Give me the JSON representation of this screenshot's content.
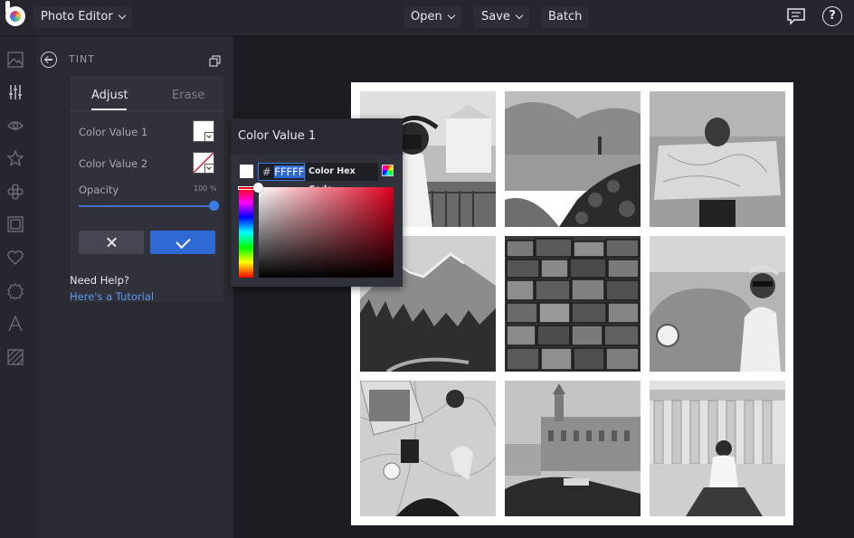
{
  "topbar": {
    "app_menu_label": "Photo Editor",
    "open_label": "Open",
    "save_label": "Save",
    "batch_label": "Batch",
    "help_glyph": "?"
  },
  "rail": {
    "icons": [
      "image-icon",
      "sliders-icon",
      "eye-icon",
      "star-icon",
      "shapes-icon",
      "frame-icon",
      "heart-icon",
      "badge-icon",
      "text-icon",
      "texture-icon"
    ]
  },
  "panel": {
    "title": "TINT",
    "tabs": {
      "adjust": "Adjust",
      "erase": "Erase"
    },
    "color_value_1_label": "Color Value 1",
    "color_value_2_label": "Color Value 2",
    "opacity_label": "Opacity",
    "opacity_value": "100 %",
    "opacity_level": 1.0,
    "help_title": "Need Help?",
    "help_link": "Here's a Tutorial"
  },
  "color_picker": {
    "title": "Color Value 1",
    "hex_prefix": "#",
    "hex_value": "FFFFF",
    "tooltip": "Color Hex Code",
    "current_color": "#ffffff"
  },
  "canvas": {
    "photos": [
      "woman-with-camera-photo",
      "rocky-coast-lighthouse-photo",
      "woman-reading-map-photo",
      "mountain-forest-road-photo",
      "stacked-suitcases-photo",
      "woman-on-vintage-car-photo",
      "map-laptop-flatlay-photo",
      "havana-street-photo",
      "man-at-ruins-photo"
    ]
  },
  "colors": {
    "accent": "#2f6ad4",
    "link": "#5b9cf0",
    "topbar_bg": "#26272e",
    "panel_bg": "#2a2b32"
  }
}
